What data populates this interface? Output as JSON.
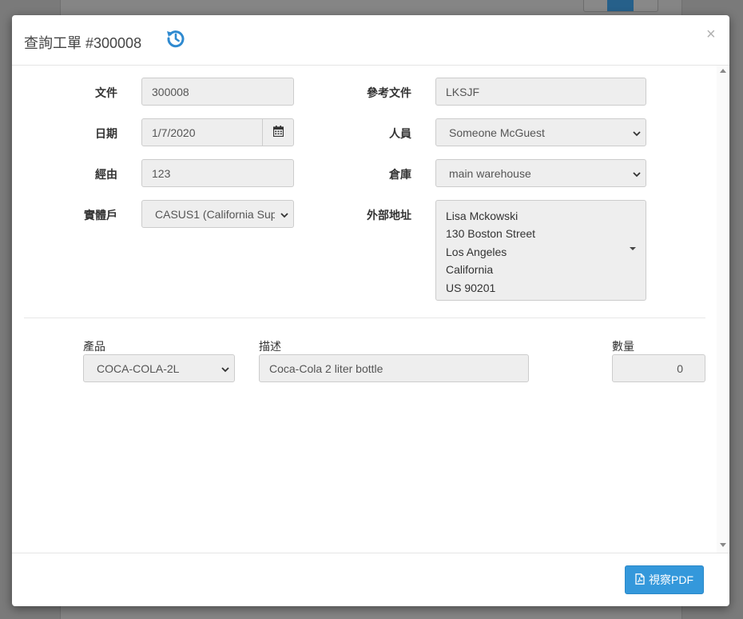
{
  "modal": {
    "title": "查詢工單 #300008",
    "close_symbol": "×"
  },
  "form": {
    "document_label": "文件",
    "document_value": "300008",
    "reference_label": "參考文件",
    "reference_value": "LKSJF",
    "date_label": "日期",
    "date_value": "1/7/2020",
    "staff_label": "人員",
    "staff_value": "Someone McGuest",
    "via_label": "經由",
    "via_value": "123",
    "warehouse_label": "倉庫",
    "warehouse_value": "main warehouse",
    "entity_label": "實體戶",
    "entity_value": "CASUS1 (California Sup",
    "address_label": "外部地址",
    "address_lines": [
      "Lisa Mckowski",
      "130 Boston Street",
      "Los Angeles",
      "California",
      "US 90201"
    ]
  },
  "lines": {
    "product_header": "產品",
    "description_header": "描述",
    "quantity_header": "數量",
    "product_value": "COCA-COLA-2L",
    "description_value": "Coca-Cola 2 liter bottle",
    "quantity_value": "0"
  },
  "footer": {
    "pdf_button_label": "視察PDF"
  },
  "icons": {
    "history": "history-icon",
    "calendar": "calendar-icon",
    "pdf": "file-pdf-icon",
    "chevron": "chevron-down-icon"
  },
  "colors": {
    "accent": "#3498db",
    "history_icon": "#2f8ad0"
  }
}
